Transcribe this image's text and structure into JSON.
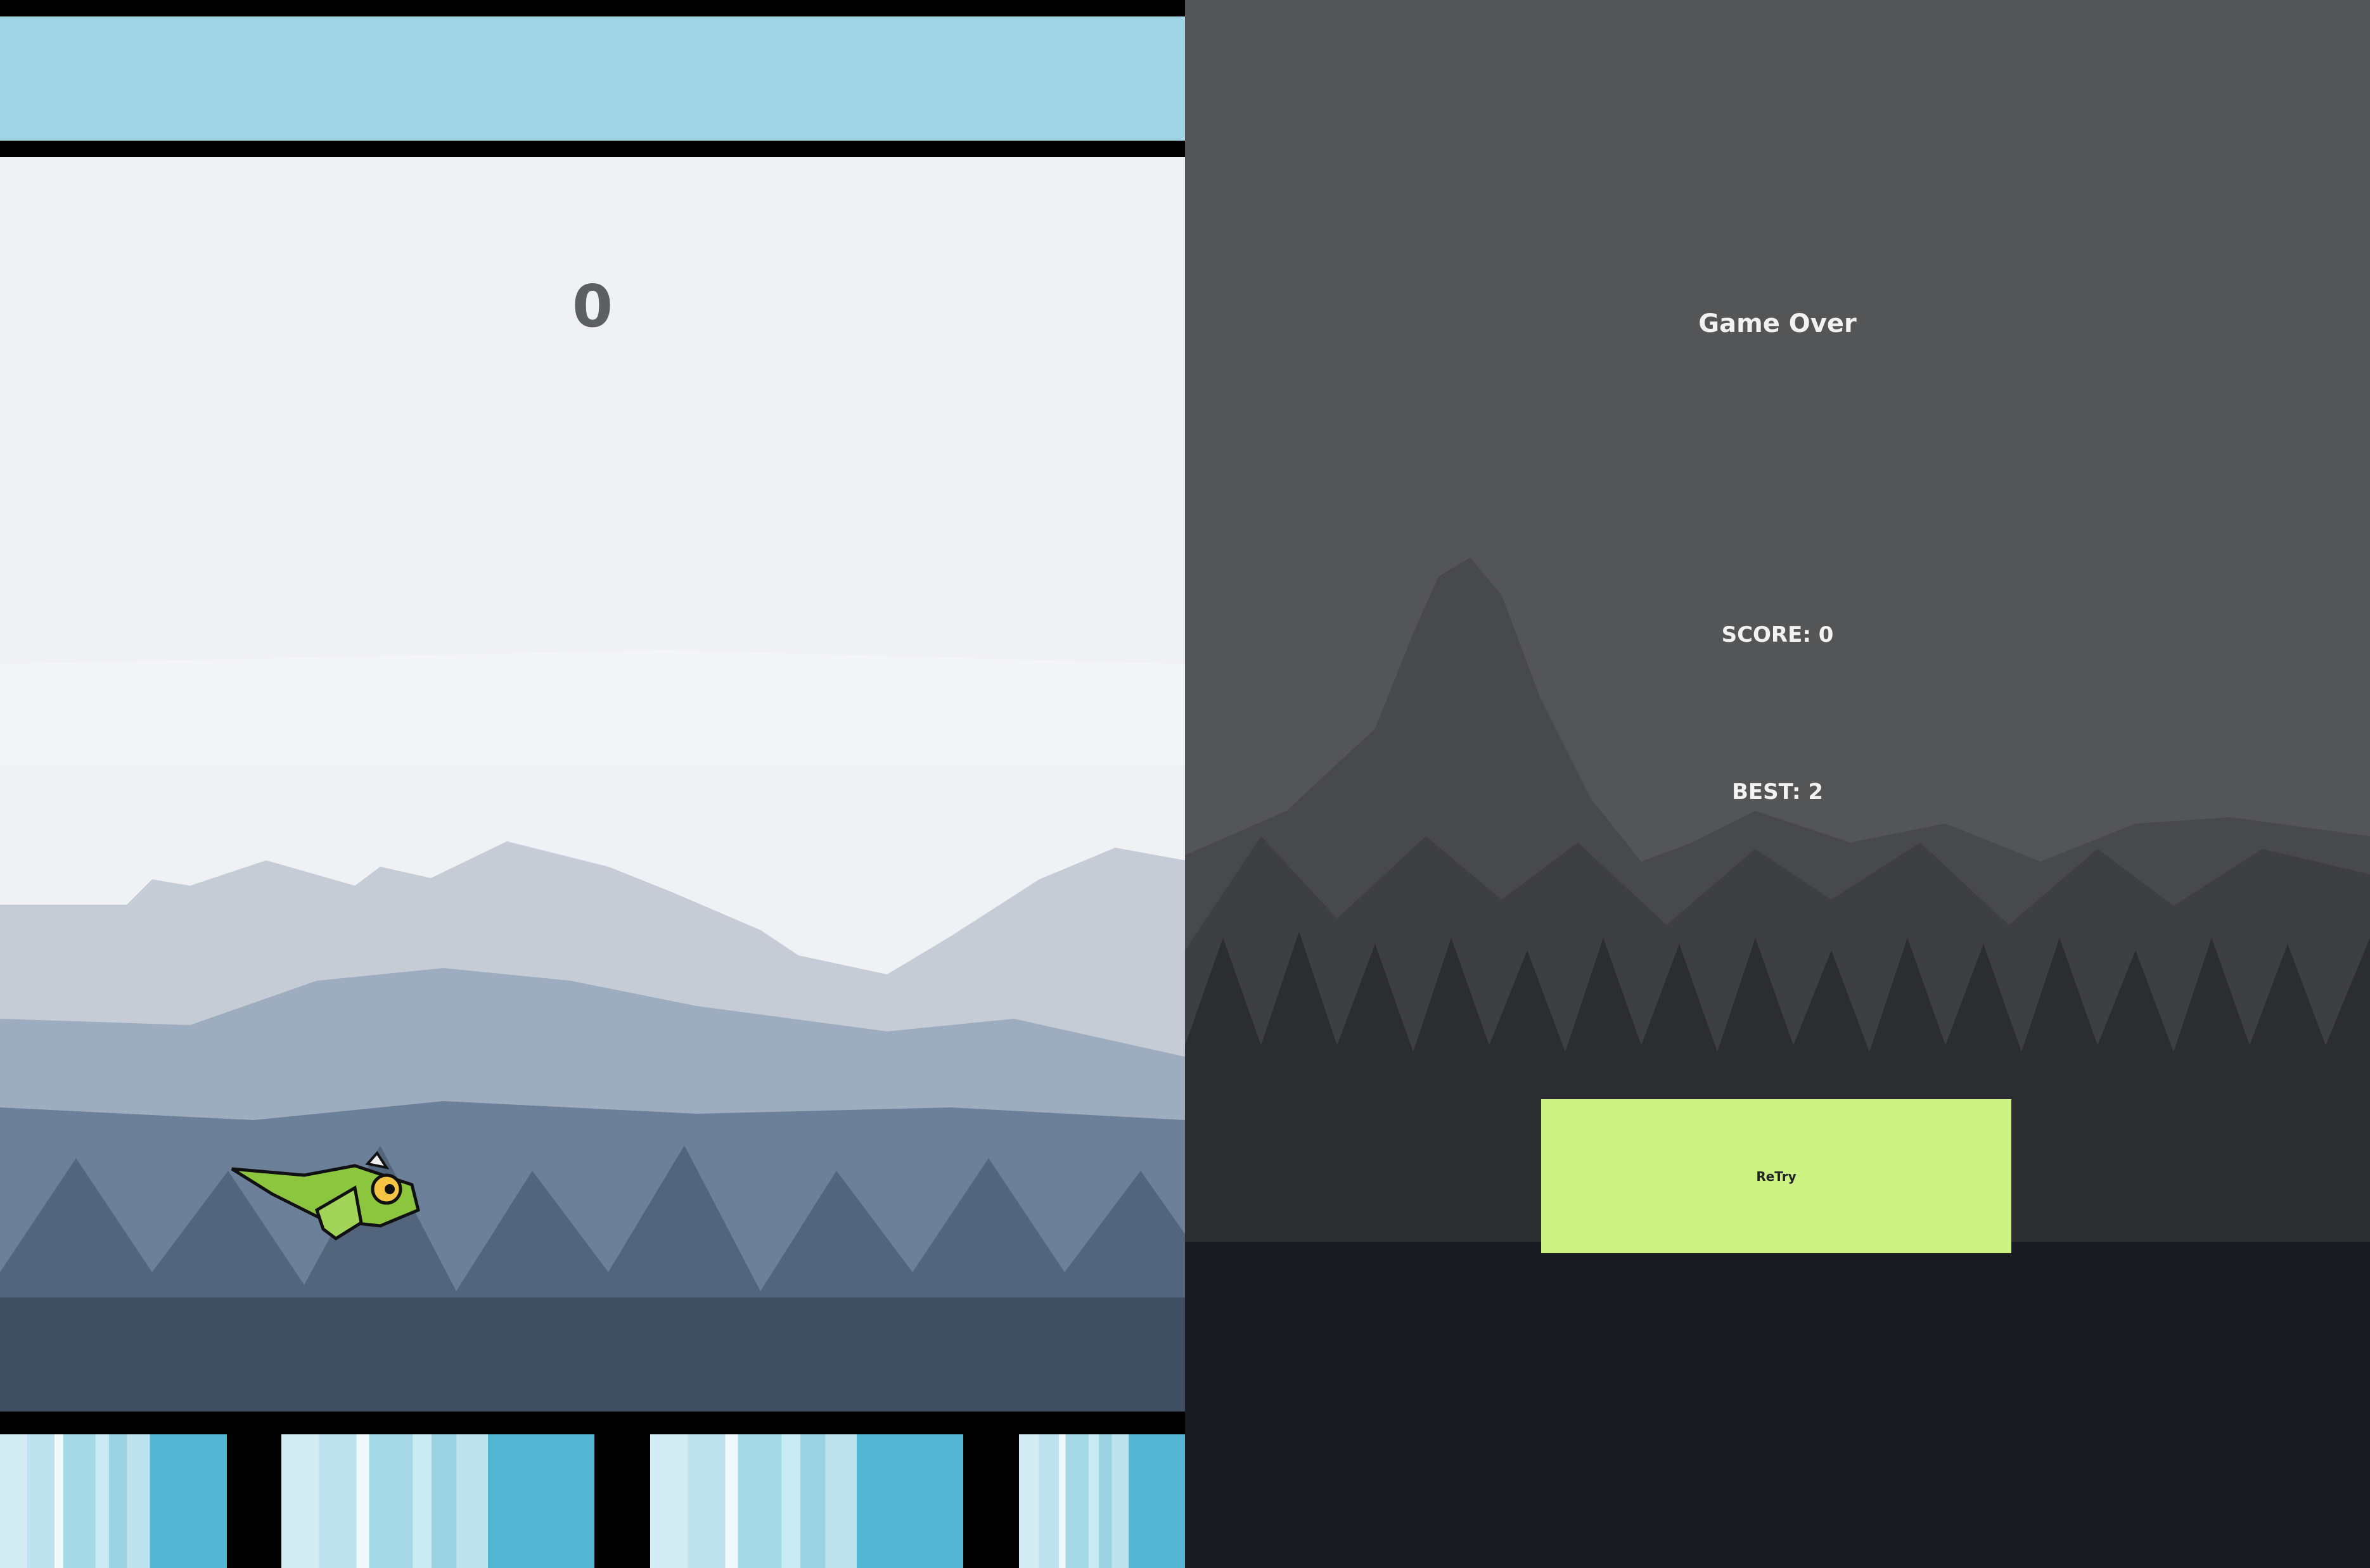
{
  "game": {
    "current_score": "0"
  },
  "game_over": {
    "title": "Game Over",
    "score_text": "SCORE: 0",
    "best_text": "BEST: 2",
    "retry_label": "ReTry"
  },
  "colors": {
    "sky": "#f0f1f4",
    "pipe": "#9fd5e4",
    "overlay": "#545557",
    "retry_button": "#ccf282",
    "bird": "#8cc63f"
  },
  "icons": {
    "player": "dragon-icon"
  }
}
